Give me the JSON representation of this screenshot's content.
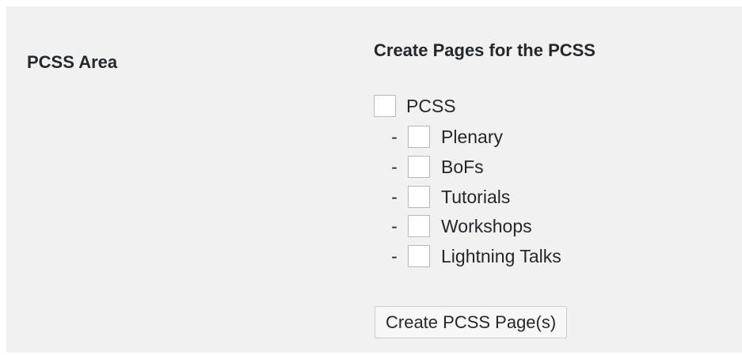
{
  "section": {
    "label": "PCSS Area"
  },
  "form": {
    "heading": "Create Pages for the PCSS",
    "parent": {
      "label": "PCSS",
      "checked": false
    },
    "children": [
      {
        "dash": "-",
        "label": "Plenary",
        "checked": false
      },
      {
        "dash": "-",
        "label": "BoFs",
        "checked": false
      },
      {
        "dash": "-",
        "label": "Tutorials",
        "checked": false
      },
      {
        "dash": "-",
        "label": "Workshops",
        "checked": false
      },
      {
        "dash": "-",
        "label": "Lightning Talks",
        "checked": false
      }
    ],
    "submit_label": "Create PCSS Page(s)"
  },
  "colors": {
    "panel_background": "#f1f1f1",
    "text": "#23282d",
    "checkbox_border": "#b4b9be",
    "button_background": "#f7f7f7",
    "button_border": "#cccccc"
  }
}
